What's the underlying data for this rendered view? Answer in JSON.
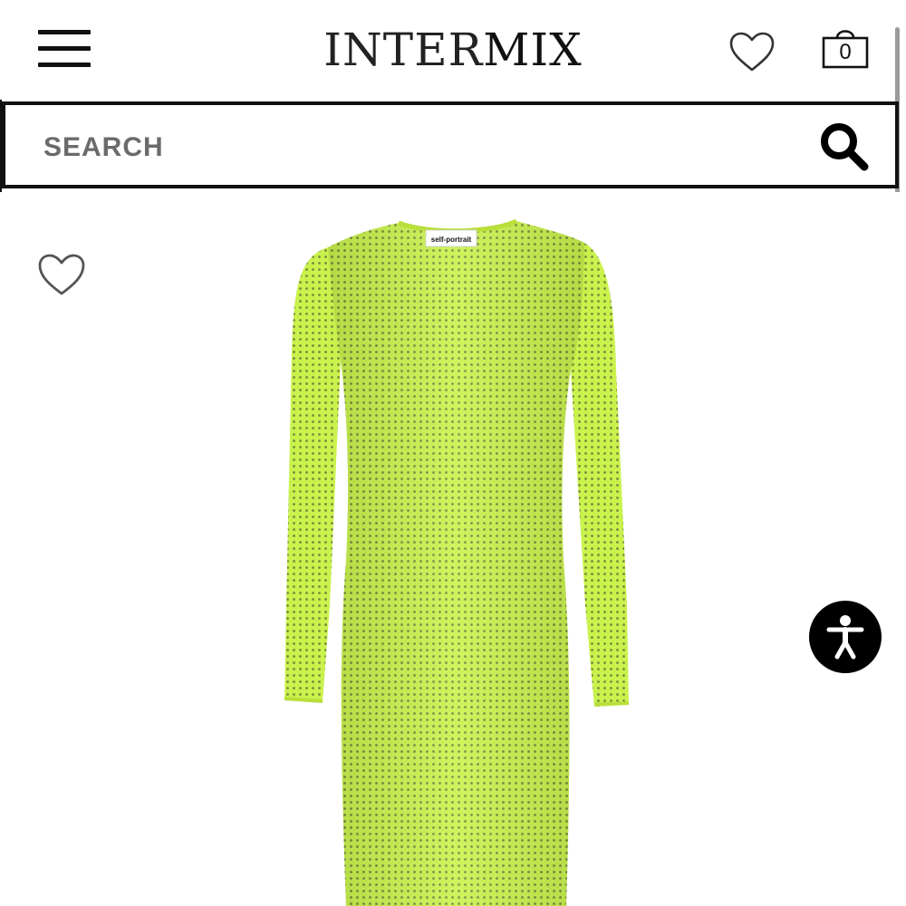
{
  "header": {
    "logo_thin": "INTER",
    "logo_bold": "MIX",
    "cart_count": "0",
    "menu_icon": "hamburger-menu-icon",
    "wishlist_icon": "heart-icon",
    "cart_icon": "shopping-bag-icon"
  },
  "search": {
    "placeholder": "SEARCH",
    "icon": "search-icon"
  },
  "product": {
    "wishlist_icon": "heart-outline-icon",
    "image_brand_label": "self-portrait",
    "dress_color": "#c8f24a"
  },
  "accessibility": {
    "icon": "accessibility-person-icon",
    "color": "#000000"
  }
}
